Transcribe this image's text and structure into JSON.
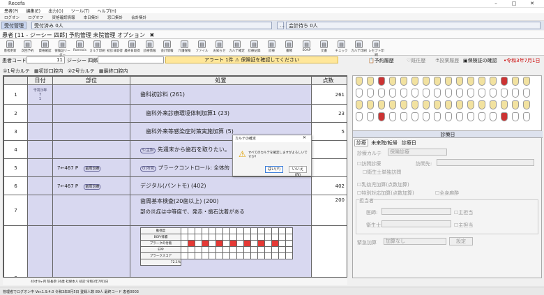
{
  "window": {
    "title": "Recefa"
  },
  "menu": [
    "患者(P)",
    "編集(E)",
    "出力(O)",
    "ツール(T)",
    "ヘルプ(H)"
  ],
  "toolbar1": [
    "ログオン",
    "ログオフ",
    "資格確認情報",
    "本日集計",
    "窓口集計",
    "会計集計"
  ],
  "tabs": {
    "uketsuke": "受付管理",
    "uketsuke_zumi": "受付済み 0人",
    "kaikei": "会計待ち 0人"
  },
  "patient_bar": {
    "label": "患者 [11 - ジーシー 四郎] 予約管理 未院管理 オプション"
  },
  "icon_buttons": [
    "患者更新",
    "次回予約",
    "資格確認",
    "保険証リーダー",
    "Romexis",
    "カルテ印刷",
    "初診日取得",
    "最終日取得",
    "診療情報",
    "会計情報",
    "介護保険",
    "ファイル",
    "お知らせ",
    "カルテ確定",
    "診療記録",
    "診療",
    "書類",
    "SOAP",
    "文書",
    "チェック",
    "カルテ印刷",
    "レセプト印刷"
  ],
  "patient_info": {
    "code_label": "患者コード",
    "code_value": "11",
    "name": "ジーシー 四郎"
  },
  "alert": {
    "text": "アラート 1件 ⚠ 保険証を確認してください"
  },
  "history": {
    "yoyaku": "予約履歴",
    "kiou": "既往歴",
    "toyaku": "投薬履歴",
    "hoken": "保険証の確認",
    "date": "令和3年7月1日"
  },
  "subtabs": [
    "1号カルテ",
    "初診口腔内",
    "2号カルテ",
    "最終口腔内"
  ],
  "karte": {
    "headers": {
      "date": "日付",
      "site": "部位",
      "proc": "処置",
      "pts": "点数"
    },
    "rows": [
      {
        "no": "1",
        "date": "令和3年\n7\n1",
        "site": "",
        "proc": "歯科初診料 (261)",
        "pts": "261"
      },
      {
        "no": "2",
        "date": "",
        "site": "",
        "proc": "歯科外来診療環境体制加算1 (23)",
        "pts": "23"
      },
      {
        "no": "3",
        "date": "",
        "site": "",
        "proc": "歯科外来等感染症対策実施加算 (5)",
        "pts": "5"
      },
      {
        "no": "4",
        "date": "",
        "site": "",
        "proc": "先週末から歯石を取りたい。",
        "tag": "S:主訴",
        "pts": ""
      },
      {
        "no": "5",
        "date": "",
        "site": "7←467  P",
        "tag2": "歯周治療",
        "proc": "プラークコントロール: 全体的",
        "tag": "O:所見",
        "pts": ""
      },
      {
        "no": "6",
        "date": "",
        "site": "7←467  P",
        "tag2": "歯周治療",
        "proc": "デジタル(パントモ) (402)",
        "pts": "402"
      },
      {
        "no": "7",
        "date": "",
        "site": "",
        "proc": "歯周基本検査(20歯以上) (200)",
        "sub": "部の炎症は中等度で、発赤・歯石沈着がある",
        "pts": "200"
      },
      {
        "no": "8",
        "date": "",
        "site": "",
        "proc": "",
        "pts": ""
      }
    ],
    "mini_labels": [
      "動揺度",
      "BOP/排膿",
      "プラークの付着",
      "EPP",
      "プラークスコア"
    ],
    "mini_pct": "72.1%",
    "footer": "40才4ヶ月   院長参:36歳   社保本人   初診:令和3年7月1日"
  },
  "right": {
    "section_title": "診療日",
    "tabs": [
      "診療",
      "未来院/転帰",
      "診療日"
    ],
    "karte_label": "診療カルテ",
    "karte_value": "保険診療",
    "houmon": "訪問診療",
    "eisei": "衛生士単独訪問",
    "houmonsaki": "訪問先:",
    "nyuyouji": "乳幼児加算(点数加算)",
    "tokubetsu": "特別対応加算(点数加算)",
    "zenshin": "全身麻酔",
    "tantou": "担当者",
    "ishi": "医師:",
    "eiseishi": "衛生士:",
    "shu": "主担当",
    "kinkyu_label": "緊急加算",
    "kinkyu_value": "加算なし",
    "settei": "設定"
  },
  "dialog": {
    "title": "カルテの確定",
    "message": "すべてのカルテを確定しますがよろしいですか？",
    "yes": "はい(Y)",
    "no": "いいえ(N)"
  },
  "status": {
    "text": "管理者でログオン中   Ver.1.9.4.0   令和3年8月5日  登録人数 89人  最終コード 患者0003"
  }
}
